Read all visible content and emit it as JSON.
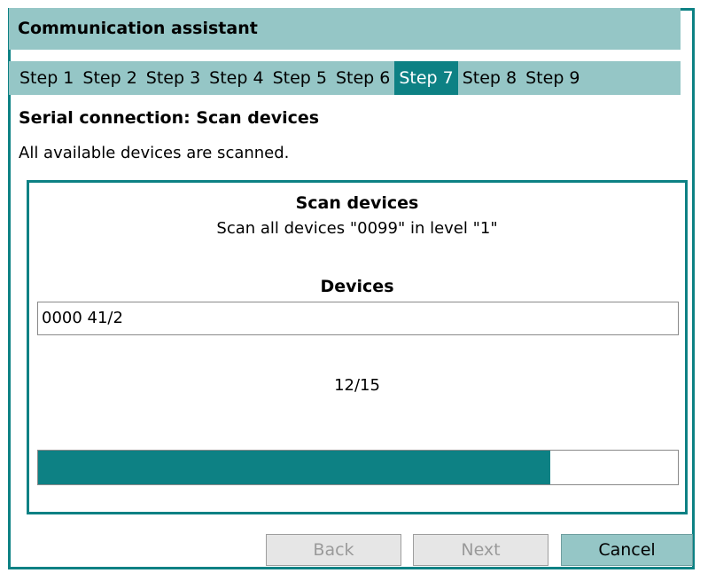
{
  "window": {
    "title": "Communication assistant"
  },
  "steps": [
    {
      "label": "Step 1",
      "active": false
    },
    {
      "label": "Step 2",
      "active": false
    },
    {
      "label": "Step 3",
      "active": false
    },
    {
      "label": "Step 4",
      "active": false
    },
    {
      "label": "Step 5",
      "active": false
    },
    {
      "label": "Step 6",
      "active": false
    },
    {
      "label": "Step 7",
      "active": true
    },
    {
      "label": "Step 8",
      "active": false
    },
    {
      "label": "Step 9",
      "active": false
    }
  ],
  "page": {
    "heading": "Serial connection: Scan devices",
    "description": "All available devices are scanned."
  },
  "scan": {
    "title": "Scan devices",
    "subtitle": "Scan all devices \"0099\" in level \"1\"",
    "devices_label": "Devices",
    "device_value": "0000 41/2",
    "count_text": "12/15",
    "progress_fraction": 0.8
  },
  "buttons": {
    "back": "Back",
    "next": "Next",
    "cancel": "Cancel"
  },
  "colors": {
    "accent": "#0d8184",
    "accent_light": "#95c6c6"
  }
}
